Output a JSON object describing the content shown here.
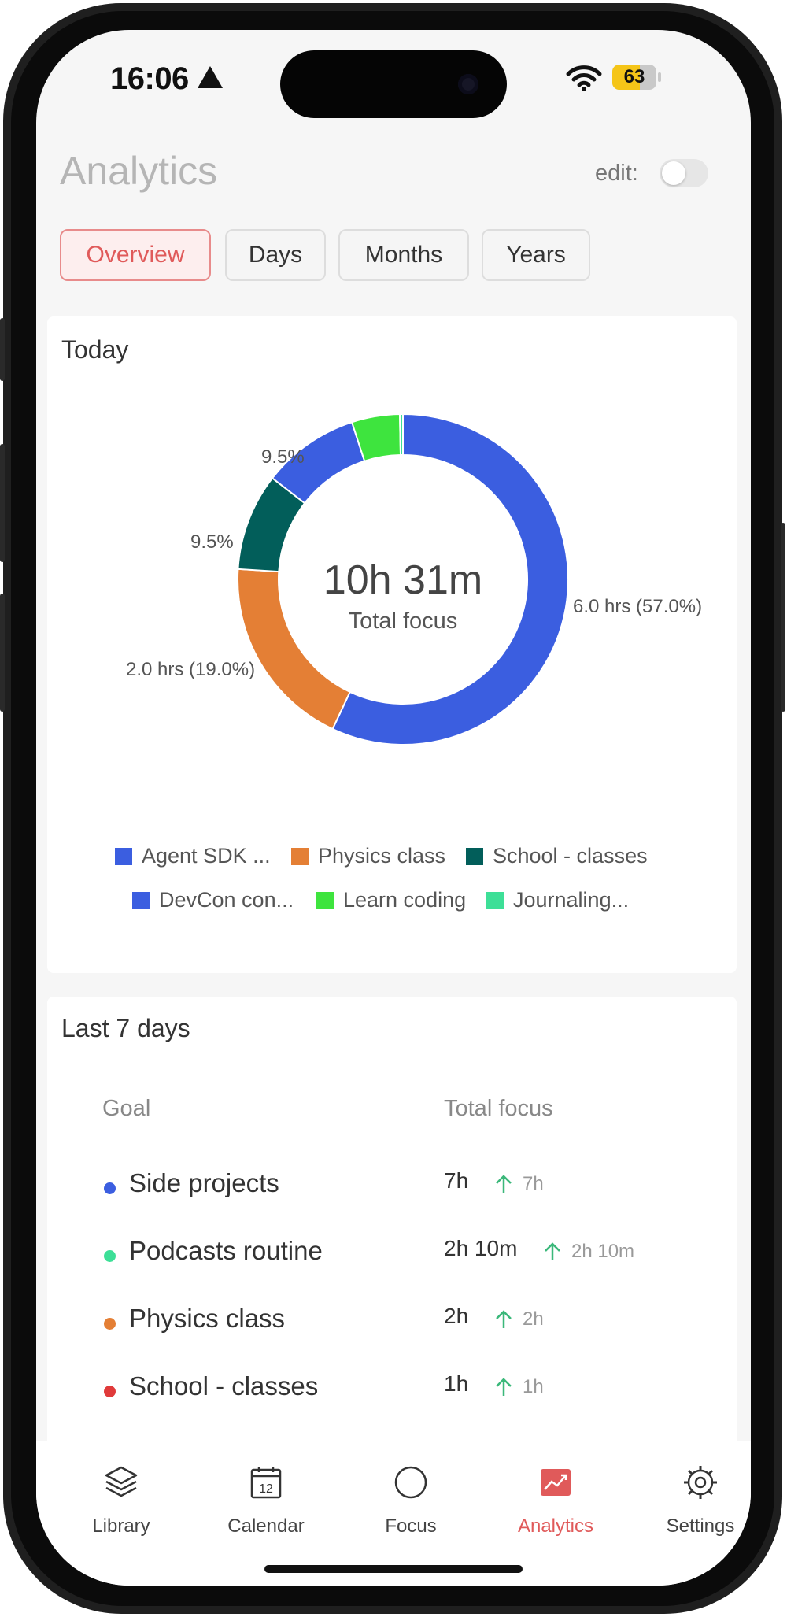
{
  "status_bar": {
    "time": "16:06",
    "battery_level": "63",
    "battery_fraction": 0.63
  },
  "header": {
    "title": "Analytics",
    "edit_label": "edit:"
  },
  "tabs": [
    {
      "label": "Overview",
      "active": true
    },
    {
      "label": "Days",
      "active": false
    },
    {
      "label": "Months",
      "active": false
    },
    {
      "label": "Years",
      "active": false
    }
  ],
  "today": {
    "title": "Today",
    "center_value": "10h 31m",
    "center_label": "Total focus",
    "chart_data": {
      "type": "pie",
      "slices": [
        {
          "name": "Agent SDK ...",
          "value": 57.0,
          "color": "#3b5ee0",
          "label": "6.0 hrs (57.0%)"
        },
        {
          "name": "Physics class",
          "value": 19.0,
          "color": "#e47f35",
          "label": "2.0 hrs (19.0%)"
        },
        {
          "name": "School - classes",
          "value": 9.5,
          "color": "#025e5a",
          "label": "9.5%"
        },
        {
          "name": "DevCon con...",
          "value": 9.5,
          "color": "#3b5ee0",
          "label": "9.5%"
        },
        {
          "name": "Learn coding",
          "value": 4.7,
          "color": "#3ee43e",
          "label": ""
        },
        {
          "name": "Journaling...",
          "value": 0.3,
          "color": "#3ddf97",
          "label": ""
        }
      ]
    }
  },
  "last7": {
    "title": "Last 7 days",
    "col_goal": "Goal",
    "col_total": "Total focus",
    "rows": [
      {
        "name": "Side projects",
        "value": "7h",
        "delta": "7h",
        "color": "#3b5ee0"
      },
      {
        "name": "Podcasts routine",
        "value": "2h 10m",
        "delta": "2h 10m",
        "color": "#3ddf97"
      },
      {
        "name": "Physics class",
        "value": "2h",
        "delta": "2h",
        "color": "#e47f35"
      },
      {
        "name": "School - classes",
        "value": "1h",
        "delta": "1h",
        "color": "#e03a3a"
      }
    ]
  },
  "tabbar": [
    {
      "label": "Library",
      "icon": "layers-icon",
      "active": false
    },
    {
      "label": "Calendar",
      "icon": "calendar-icon",
      "date": "12",
      "active": false
    },
    {
      "label": "Focus",
      "icon": "circle-icon",
      "active": false
    },
    {
      "label": "Analytics",
      "icon": "chart-icon",
      "active": true
    },
    {
      "label": "Settings",
      "icon": "gear-icon",
      "active": false
    }
  ],
  "colors": {
    "accent": "#e05a5a",
    "trend_up": "#3bb87a"
  }
}
